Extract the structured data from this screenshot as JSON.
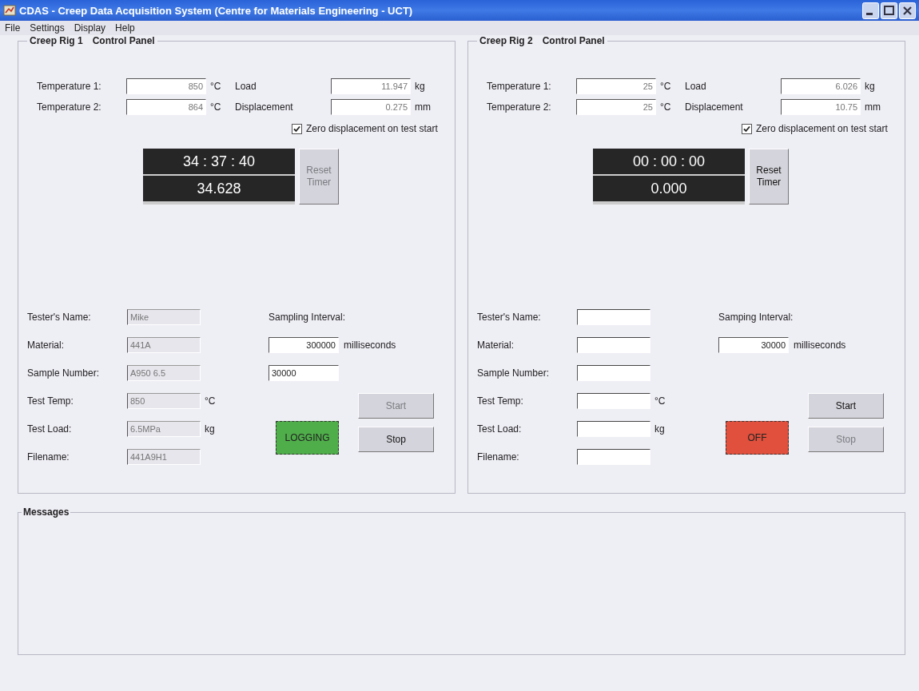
{
  "window": {
    "title": "CDAS - Creep Data Acquisition System (Centre for Materials Engineering - UCT)"
  },
  "menu": [
    {
      "label": "File"
    },
    {
      "label": "Settings"
    },
    {
      "label": "Display"
    },
    {
      "label": "Help"
    }
  ],
  "rigs": [
    {
      "title": "Creep Rig 1",
      "subtitle": "Control Panel",
      "readings": [
        {
          "label": "Temperature 1:",
          "value": "850",
          "unit": "°C"
        },
        {
          "label": "Load",
          "value": "11.947",
          "unit": "kg"
        },
        {
          "label": "Temperature 2:",
          "value": "864",
          "unit": "°C"
        },
        {
          "label": "Displacement",
          "value": "0.275",
          "unit": "mm"
        }
      ],
      "zero_displacement": {
        "label": "Zero displacement on test start",
        "checked": true
      },
      "timer": {
        "clock": "34 : 37 : 40",
        "hours": "34.628"
      },
      "reset_button": {
        "label": "Reset Timer",
        "disabled": true
      },
      "details": [
        {
          "label": "Tester's Name:",
          "value": "Mike",
          "disabled": true
        },
        {
          "label": "Material:",
          "value": "441A",
          "disabled": true
        },
        {
          "label": "Sample Number:",
          "value": "A950 6.5",
          "disabled": true
        },
        {
          "label": "Test Temp:",
          "value": "850",
          "unit": "°C",
          "disabled": true
        },
        {
          "label": "Test Load:",
          "value": "6.5MPa",
          "unit": "kg",
          "disabled": true
        },
        {
          "label": "Filename:",
          "value": "441A9H1",
          "disabled": true
        }
      ],
      "sampling": {
        "label": "Sampling Interval:",
        "fields": [
          {
            "value": "300000"
          },
          {
            "value": "30000"
          }
        ],
        "unit": "milliseconds"
      },
      "status": {
        "label": "LOGGING",
        "color": "#4fae4a"
      },
      "buttons": [
        {
          "label": "Start",
          "disabled": true
        },
        {
          "label": "Stop",
          "disabled": false
        }
      ]
    },
    {
      "title": "Creep Rig 2",
      "subtitle": "Control Panel",
      "readings": [
        {
          "label": "Temperature 1:",
          "value": "25",
          "unit": "°C"
        },
        {
          "label": "Load",
          "value": "6.026",
          "unit": "kg"
        },
        {
          "label": "Temperature 2:",
          "value": "25",
          "unit": "°C"
        },
        {
          "label": "Displacement",
          "value": "10.75",
          "unit": "mm"
        }
      ],
      "zero_displacement": {
        "label": "Zero displacement on test start",
        "checked": true
      },
      "timer": {
        "clock": "00 : 00 : 00",
        "hours": "0.000"
      },
      "reset_button": {
        "label": "Reset Timer",
        "disabled": false
      },
      "details": [
        {
          "label": "Tester's Name:",
          "disabled": false
        },
        {
          "label": "Material:",
          "disabled": false
        },
        {
          "label": "Sample Number:",
          "disabled": false
        },
        {
          "label": "Test Temp:",
          "unit": "°C",
          "disabled": false
        },
        {
          "label": "Test Load:",
          "unit": "kg",
          "disabled": false
        },
        {
          "label": "Filename:",
          "disabled": false
        }
      ],
      "sampling": {
        "label": "Samping Interval:",
        "fields": [
          {
            "value": "30000"
          }
        ],
        "unit": "milliseconds"
      },
      "status": {
        "label": "OFF",
        "color": "#e0503c"
      },
      "buttons": [
        {
          "label": "Start",
          "disabled": false
        },
        {
          "label": "Stop",
          "disabled": true
        }
      ]
    }
  ],
  "messages": {
    "title": "Messages"
  }
}
